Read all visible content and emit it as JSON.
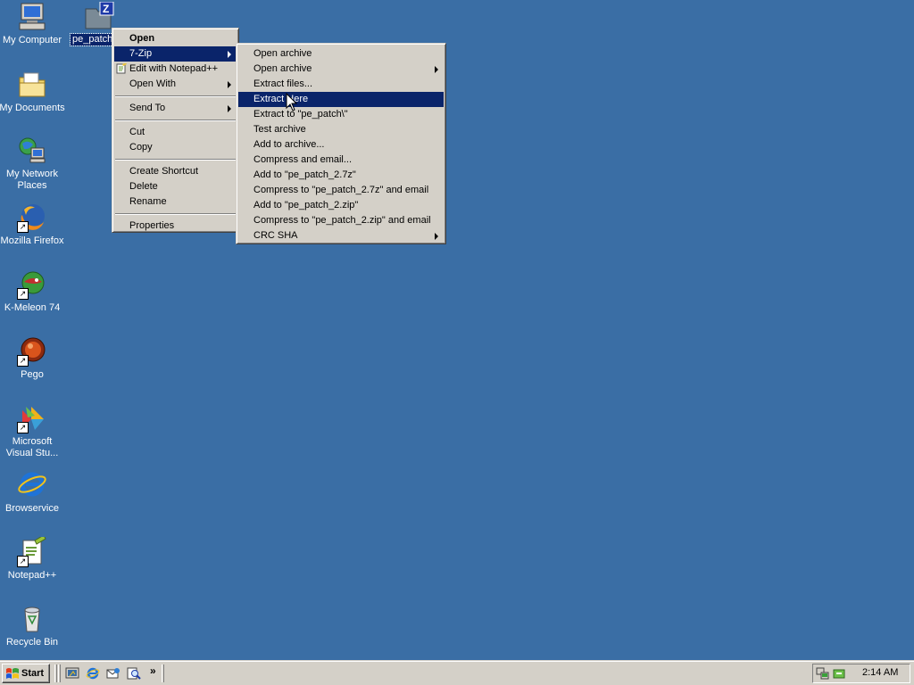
{
  "desktop": {
    "icons": [
      {
        "label": "My Computer",
        "icon": "my-computer-icon"
      },
      {
        "label": "My Documents",
        "icon": "my-documents-icon"
      },
      {
        "label": "My Network Places",
        "icon": "network-places-icon"
      },
      {
        "label": "Mozilla Firefox",
        "icon": "firefox-icon"
      },
      {
        "label": "K-Meleon 74",
        "icon": "k-meleon-icon"
      },
      {
        "label": "Pego",
        "icon": "pego-icon"
      },
      {
        "label": "Microsoft Visual Stu...",
        "icon": "visual-studio-icon"
      },
      {
        "label": "Browservice",
        "icon": "internet-explorer-icon"
      },
      {
        "label": "Notepad++",
        "icon": "notepad-plus-plus-icon"
      },
      {
        "label": "Recycle Bin",
        "icon": "recycle-bin-icon"
      }
    ],
    "selected_file": {
      "label": "pe_patch",
      "icon": "7zip-archive-icon"
    },
    "background_color": "#3a6ea5"
  },
  "context_menu": {
    "items": {
      "open": "Open",
      "seven_zip": "7-Zip",
      "edit_notepad": "Edit with Notepad++",
      "open_with": "Open With",
      "send_to": "Send To",
      "cut": "Cut",
      "copy": "Copy",
      "create_shortcut": "Create Shortcut",
      "delete": "Delete",
      "rename": "Rename",
      "properties": "Properties"
    }
  },
  "zip_submenu": {
    "items": {
      "open_archive": "Open archive",
      "open_archive_sub": "Open archive",
      "extract_files": "Extract files...",
      "extract_here": "Extract Here",
      "extract_to": "Extract to \"pe_patch\\\"",
      "test_archive": "Test archive",
      "add_to_archive": "Add to archive...",
      "compress_email": "Compress and email...",
      "add_7z": "Add to \"pe_patch_2.7z\"",
      "compress_7z_email": "Compress to \"pe_patch_2.7z\" and email",
      "add_zip": "Add to \"pe_patch_2.zip\"",
      "compress_zip_email": "Compress to \"pe_patch_2.zip\" and email",
      "crc_sha": "CRC SHA"
    }
  },
  "taskbar": {
    "start_label": "Start",
    "quicklaunch_more": "»",
    "clock": "2:14 AM"
  },
  "colors": {
    "highlight": "#0a246a",
    "menu_face": "#d4d0c8"
  }
}
